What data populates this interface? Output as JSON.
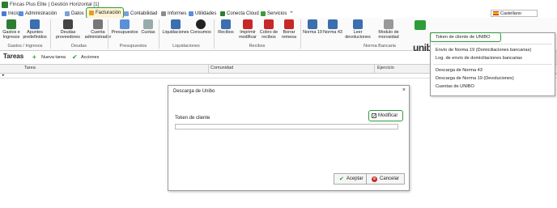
{
  "window": {
    "title": "Fincas Plus Elite | Gestión Horizontal [1]"
  },
  "tabs": [
    {
      "label": "Inicio",
      "color": "#4a7bd0"
    },
    {
      "label": "Administración",
      "color": "#5b8fd6"
    },
    {
      "label": "Datos",
      "color": "#7aa0d8"
    },
    {
      "label": "Facturación",
      "color": "#e0a020"
    },
    {
      "label": "Contabilidad",
      "color": "#7aa0d8"
    },
    {
      "label": "Informes",
      "color": "#8c8c8c"
    },
    {
      "label": "Utilidades",
      "color": "#5b8fd6"
    },
    {
      "label": "Conecta Cloud",
      "color": "#2e7d32"
    },
    {
      "label": "Servicios",
      "color": "#3a9a3a"
    }
  ],
  "language": {
    "value": "Castellano"
  },
  "ribbon": {
    "buttons": [
      {
        "label": "Gastos e Ingresos",
        "color": "#2e7d32"
      },
      {
        "label": "Apuntes predefinidos",
        "color": "#3b6fb0"
      },
      {
        "label": "Deudas proveedores",
        "color": "#444"
      },
      {
        "label": "Cuenta administrador",
        "color": "#777"
      },
      {
        "label": "Presupuestos",
        "color": "#5b8fd6"
      },
      {
        "label": "Cuotas",
        "color": "#9aa"
      },
      {
        "label": "Liquidaciones",
        "color": "#3b6fb0"
      },
      {
        "label": "Consumos",
        "color": "#222"
      },
      {
        "label": "Recibos",
        "color": "#3b6fb0"
      },
      {
        "label": "Imprimir modificar",
        "color": "#c62828"
      },
      {
        "label": "Cobro de recibos",
        "color": "#c62828"
      },
      {
        "label": "Borrar remesa",
        "color": "#c62828"
      },
      {
        "label": "Norma 19",
        "color": "#3b6fb0"
      },
      {
        "label": "Norma 43",
        "color": "#3b6fb0"
      },
      {
        "label": "Leer devoluciones",
        "color": "#3b6fb0"
      },
      {
        "label": "Modulo de morosidad",
        "color": "#999"
      }
    ],
    "groups": [
      {
        "label": "Gastos / Ingresos"
      },
      {
        "label": "Deudas"
      },
      {
        "label": "Presupuestos"
      },
      {
        "label": "Liquidaciones"
      },
      {
        "label": "Recibos"
      },
      {
        "label": "Norma Bancaria"
      }
    ],
    "unibo_label": "unibo"
  },
  "tareas": {
    "title": "Tareas",
    "new_label": "Nueva tarea",
    "actions_label": "Acciones"
  },
  "grid": {
    "columns": [
      "Tarea",
      "Comunidad",
      "Ejercicio"
    ]
  },
  "dialog": {
    "title": "Descarga de Unibo",
    "token_label": "Token de cliente",
    "modify_label": "Modificar",
    "modify_checked": true,
    "accept_label": "Aceptar",
    "cancel_label": "Cancelar"
  },
  "menu": {
    "items": [
      {
        "label": "Token de cliente de UNIBO"
      },
      {
        "label": "Envío de Norma 19 (Domiciliaciones bancarias)"
      },
      {
        "label": "Log. de envío de domiciliaciones bancarias"
      },
      {
        "label": "Descarga de Norma 43"
      },
      {
        "label": "Descarga de Norma 19 (Devoluciones)"
      },
      {
        "label": "Cuentas de UNIBO"
      }
    ]
  }
}
